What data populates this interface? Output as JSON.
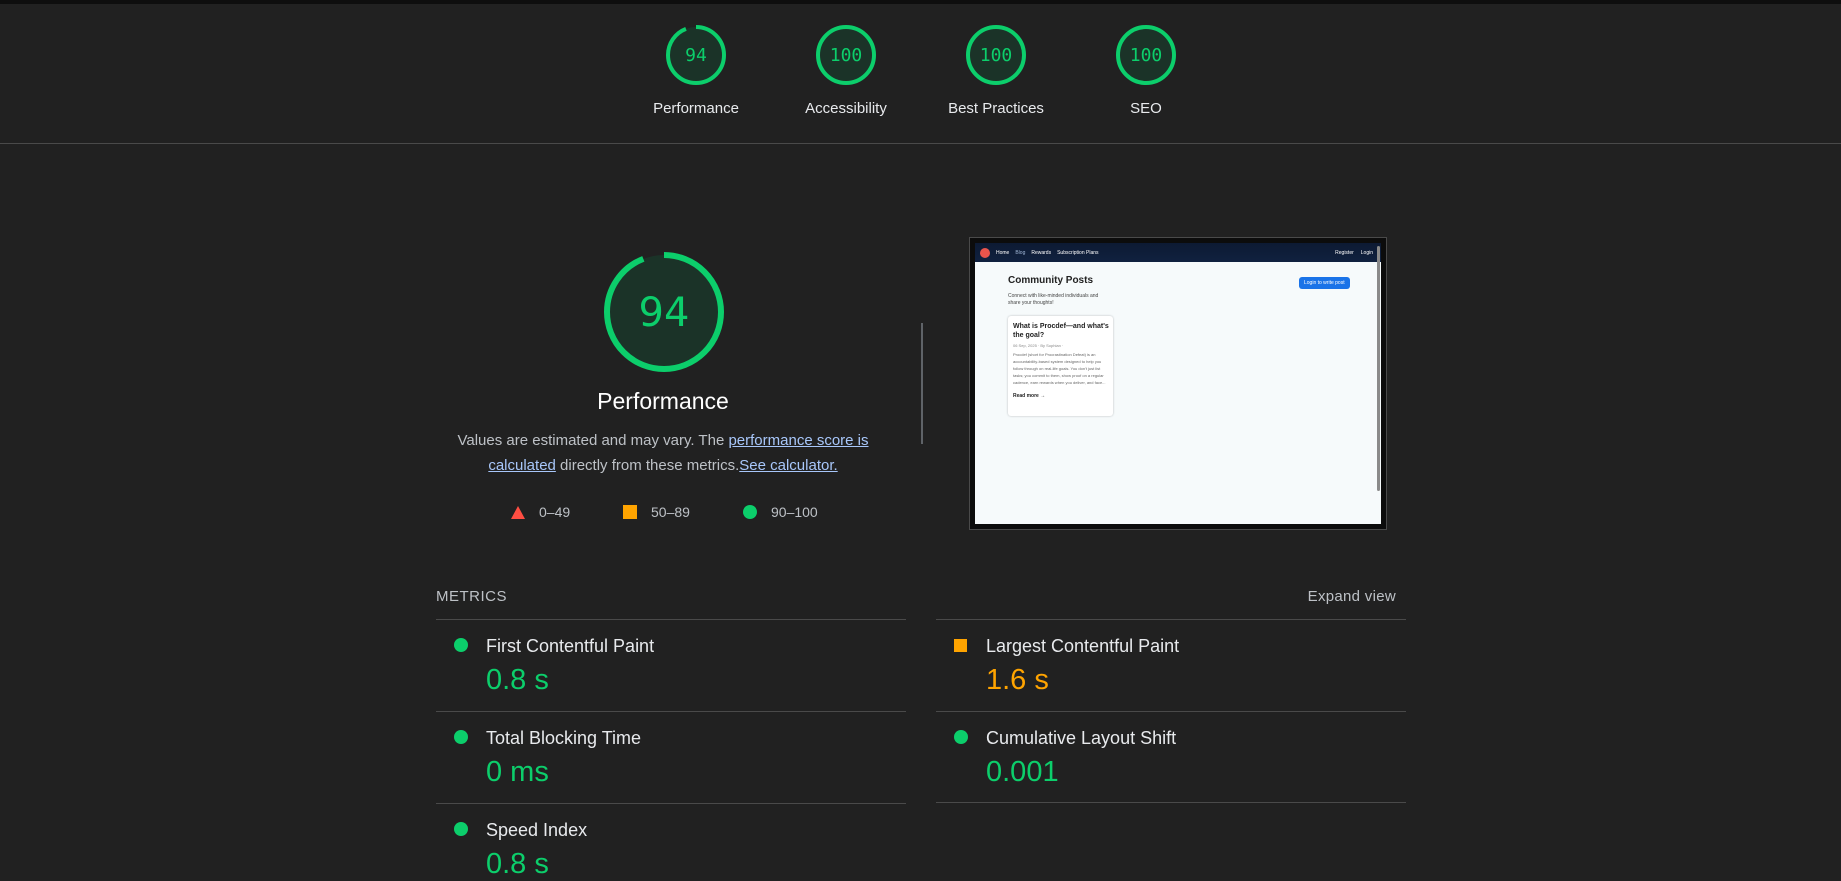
{
  "summary": {
    "gauges": [
      {
        "score": "94",
        "label": "Performance",
        "fraction": 0.94
      },
      {
        "score": "100",
        "label": "Accessibility",
        "fraction": 1.0
      },
      {
        "score": "100",
        "label": "Best Practices",
        "fraction": 1.0
      },
      {
        "score": "100",
        "label": "SEO",
        "fraction": 1.0
      }
    ]
  },
  "performance": {
    "score": "94",
    "fraction": 0.94,
    "title": "Performance",
    "desc_before": "Values are estimated and may vary. The ",
    "link_score": "performance score is calculated",
    "desc_middle": " directly from these metrics.",
    "link_calc": "See calculator.",
    "legend": {
      "fail": "0–49",
      "average": "50–89",
      "pass": "90–100"
    }
  },
  "screenshot": {
    "nav": {
      "home": "Home",
      "blog": "Blog",
      "rewards": "Rewards",
      "plans": "Subscription Plans",
      "register": "Register",
      "login": "Login"
    },
    "heading": "Community Posts",
    "subheading": "Connect with like-minded individuals and share your thoughts!",
    "button": "Login to write post",
    "card_title": "What is Procdef—and what's the goal?",
    "card_meta": "06 Sep, 2025 · By Sophian ·",
    "card_body": "Procdef (short for Procrastination Defeat) is an accountability-based system designed to help you follow through on real-life goals. You don't just list tasks; you commit to them, show proof on a regular cadence, earn rewards when you deliver, and face...",
    "card_more": "Read more →"
  },
  "metrics": {
    "heading": "METRICS",
    "expand": "Expand view",
    "items": [
      {
        "name": "First Contentful Paint",
        "value": "0.8 s",
        "rating": "pass"
      },
      {
        "name": "Largest Contentful Paint",
        "value": "1.6 s",
        "rating": "average"
      },
      {
        "name": "Total Blocking Time",
        "value": "0 ms",
        "rating": "pass"
      },
      {
        "name": "Cumulative Layout Shift",
        "value": "0.001",
        "rating": "pass"
      },
      {
        "name": "Speed Index",
        "value": "0.8 s",
        "rating": "pass"
      }
    ]
  },
  "colors": {
    "pass": "#0cce6b",
    "average": "#ffa400",
    "fail": "#ff4e42",
    "background": "#212121"
  }
}
